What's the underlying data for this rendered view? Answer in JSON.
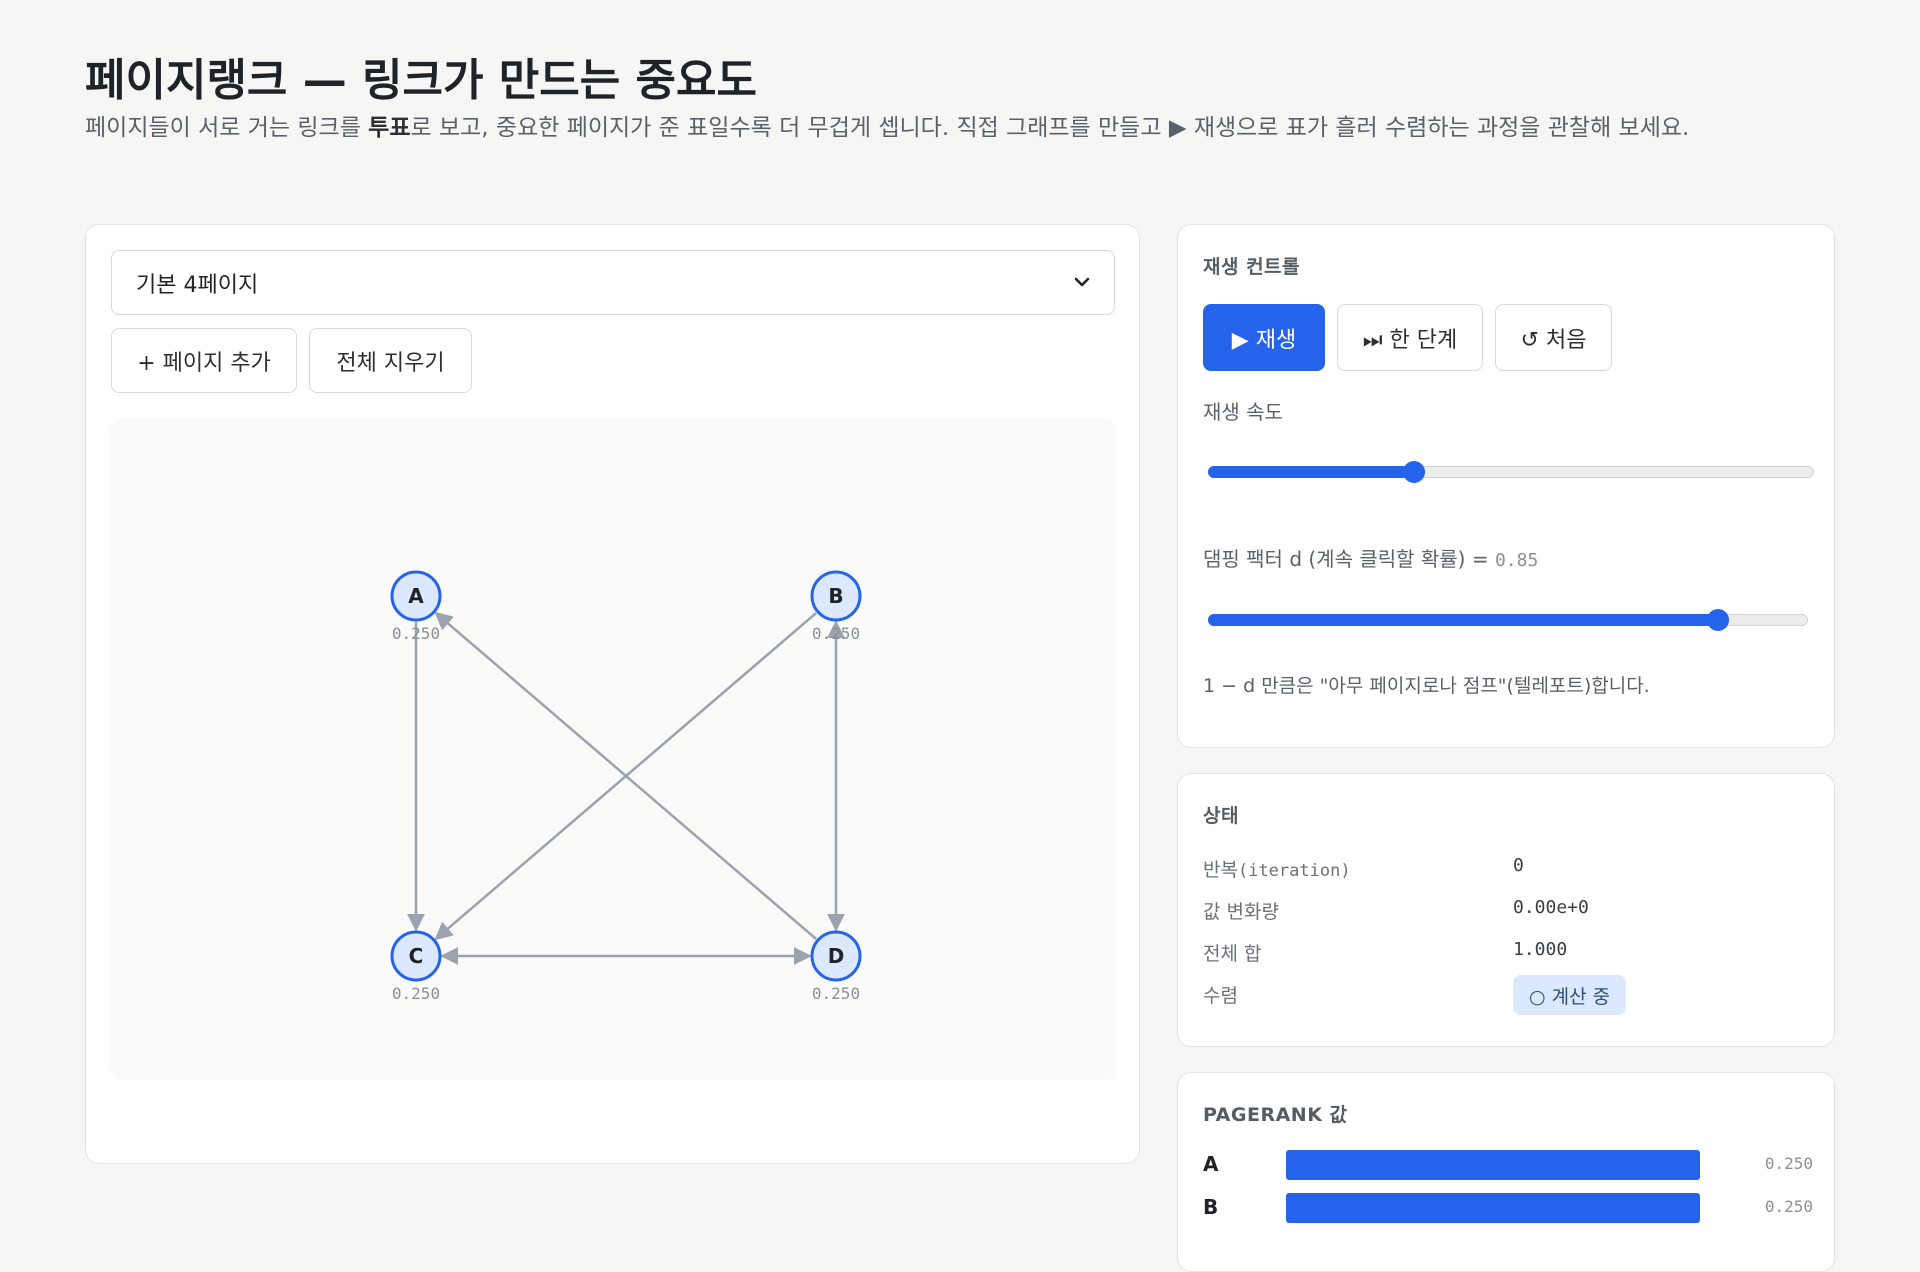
{
  "header": {
    "title": "페이지랭크 — 링크가 만드는 중요도",
    "subtitle_pre": "페이지들이 서로 거는 링크를 ",
    "subtitle_bold": "투표",
    "subtitle_post": "로 보고, 중요한 페이지가 준 표일수록 더 무겁게 셉니다. 직접 그래프를 만들고 ▶ 재생으로 표가 흘러 수렴하는 과정을 관찰해 보세요."
  },
  "editor": {
    "preset_selected": "기본 4페이지",
    "add_page_label": "+ 페이지 추가",
    "clear_label": "전체 지우기"
  },
  "graph": {
    "nodes": [
      {
        "id": "A",
        "score": "0.250"
      },
      {
        "id": "B",
        "score": "0.250"
      },
      {
        "id": "C",
        "score": "0.250"
      },
      {
        "id": "D",
        "score": "0.250"
      }
    ],
    "edges": [
      {
        "from": "A",
        "to": "C"
      },
      {
        "from": "B",
        "to": "C"
      },
      {
        "from": "B",
        "to": "D"
      },
      {
        "from": "D",
        "to": "B"
      },
      {
        "from": "D",
        "to": "A"
      },
      {
        "from": "C",
        "to": "D"
      },
      {
        "from": "D",
        "to": "C"
      }
    ],
    "colors": {
      "node_fill": "#dbe8fd",
      "node_stroke": "#2563eb",
      "edge": "#9ca3af"
    }
  },
  "controls": {
    "title": "재생 컨트롤",
    "play_label": "▶ 재생",
    "step_label": "⏭ 한 단계",
    "reset_label": "↺ 처음",
    "speed_label": "재생 속도",
    "speed_level": 0.34,
    "damping_label": "댐핑 팩터 d (계속 클릭할 확률) = ",
    "damping_value": "0.85",
    "damping_level": 0.85,
    "teleport_note": "1 − d 만큼은 \"아무 페이지로나 점프\"(텔레포트)합니다."
  },
  "state": {
    "title": "상태",
    "iteration_label": "반복",
    "iteration_label_en": "(iteration)",
    "iteration_value": "0",
    "delta_label": "값 변화량",
    "delta_value": "0.00e+0",
    "sum_label": "전체 합",
    "sum_value": "1.000",
    "converge_label": "수렴",
    "converge_badge": "○ 계산 중"
  },
  "ranks": {
    "title": "PAGERANK 값",
    "items": [
      {
        "name": "A",
        "value": "0.250",
        "level": 1.0
      },
      {
        "name": "B",
        "value": "0.250",
        "level": 1.0
      }
    ]
  },
  "colors": {
    "accent": "#2563eb",
    "badge_bg": "#dbe8fd"
  }
}
